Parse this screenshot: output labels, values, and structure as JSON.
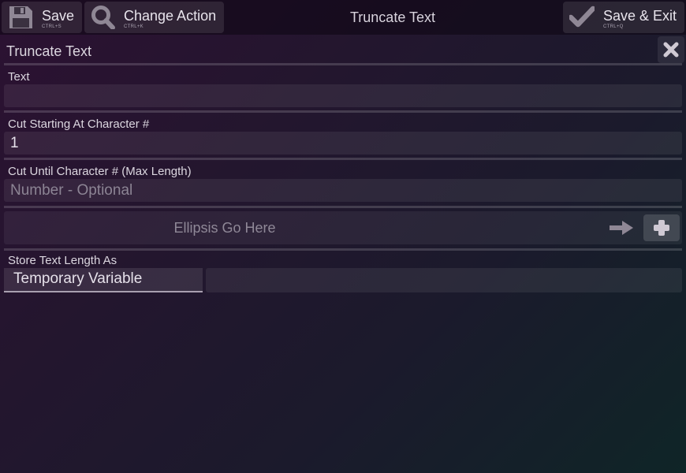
{
  "toolbar": {
    "title": "Truncate Text",
    "save": {
      "label": "Save",
      "shortcut": "CTRL+S"
    },
    "change_action": {
      "label": "Change Action",
      "shortcut": "CTRL+K"
    },
    "save_exit": {
      "label": "Save & Exit",
      "shortcut": "CTRL+Q"
    }
  },
  "panel": {
    "title": "Truncate Text",
    "fields": {
      "text": {
        "label": "Text",
        "value": "",
        "placeholder": ""
      },
      "cut_start": {
        "label": "Cut Starting At Character #",
        "value": "1"
      },
      "cut_until": {
        "label": "Cut Until Character # (Max Length)",
        "value": "",
        "placeholder": "Number - Optional"
      }
    },
    "ellipsis": {
      "placeholder": "Ellipsis Go Here"
    },
    "store": {
      "label": "Store Text Length As",
      "type": "Temporary Variable",
      "name": ""
    }
  },
  "icons": {
    "save": "floppy-disk-icon",
    "change": "magnifier-icon",
    "save_exit": "checkmark-icon",
    "close": "close-x-icon",
    "arrow": "arrow-right-icon",
    "add": "plus-icon"
  },
  "colors": {
    "icon": "#8f8795",
    "text": "#e6e1ea",
    "muted": "#8f8897"
  }
}
